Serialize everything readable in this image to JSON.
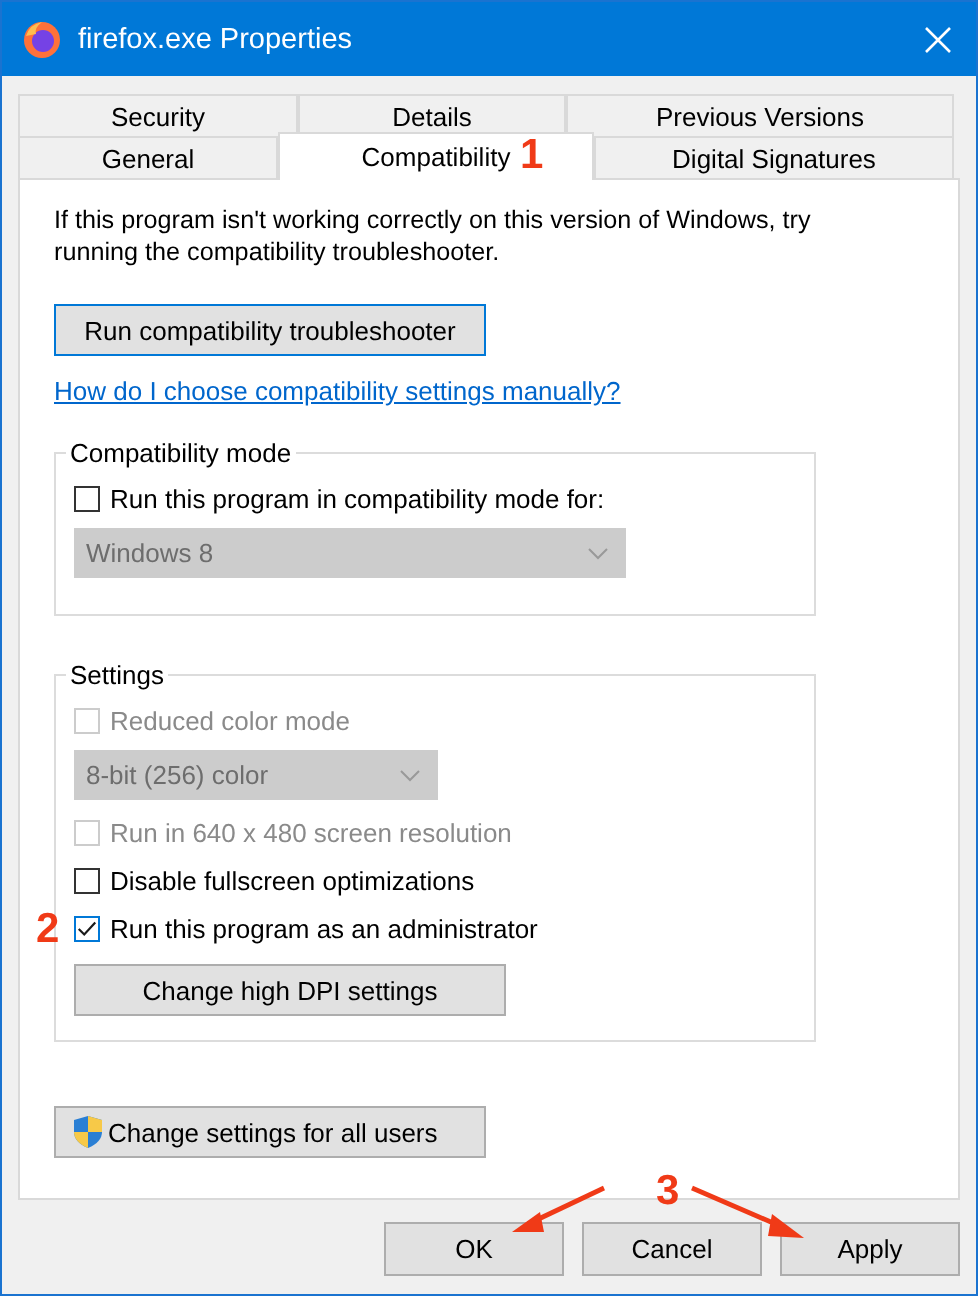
{
  "window": {
    "title": "firefox.exe Properties"
  },
  "tab_rows": [
    [
      {
        "label": "Security",
        "selected": false
      },
      {
        "label": "Details",
        "selected": false
      },
      {
        "label": "Previous Versions",
        "selected": false
      }
    ],
    [
      {
        "label": "General",
        "selected": false
      },
      {
        "label": "Compatibility",
        "selected": true,
        "annotation": "1"
      },
      {
        "label": "Digital Signatures",
        "selected": false
      }
    ]
  ],
  "description": "If this program isn't working correctly on this version of Windows, try running the compatibility troubleshooter.",
  "troubleshooter_button": "Run compatibility troubleshooter",
  "help_link": "How do I choose compatibility settings manually?",
  "groups": [
    {
      "title": "Compatibility mode",
      "items": [
        {
          "kind": "checkbox",
          "label": "Run this program in compatibility mode for:",
          "checked": false,
          "disabled": false
        },
        {
          "kind": "dropdown",
          "value": "Windows 8",
          "disabled": true
        }
      ]
    },
    {
      "title": "Settings",
      "items": [
        {
          "kind": "checkbox",
          "label": "Reduced color mode",
          "checked": false,
          "disabled": true
        },
        {
          "kind": "dropdown",
          "value": "8-bit (256) color",
          "disabled": true
        },
        {
          "kind": "checkbox",
          "label": "Run in 640 x 480 screen resolution",
          "checked": false,
          "disabled": true
        },
        {
          "kind": "checkbox",
          "label": "Disable fullscreen optimizations",
          "checked": false,
          "disabled": false
        },
        {
          "kind": "checkbox",
          "label": "Run this program as an administrator",
          "checked": true,
          "disabled": false,
          "annotation": "2"
        },
        {
          "kind": "button",
          "label": "Change high DPI settings"
        }
      ]
    }
  ],
  "all_users_button": "Change settings for all users",
  "footer": {
    "annotation": "3",
    "buttons": [
      {
        "label": "OK",
        "arrow": true
      },
      {
        "label": "Cancel",
        "arrow": false
      },
      {
        "label": "Apply",
        "arrow": true
      }
    ]
  }
}
